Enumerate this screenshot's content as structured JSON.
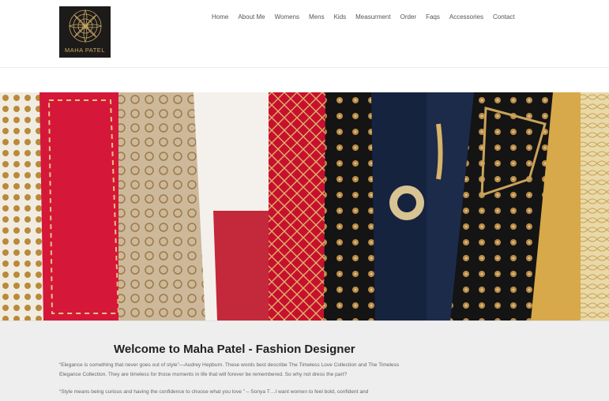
{
  "brand": {
    "logo_text": "MAHA PATEL",
    "logo_monogram": "M",
    "gold": "#c9a865",
    "dark": "#1d1b1a"
  },
  "nav": [
    "Home",
    "About Me",
    "Womens",
    "Mens",
    "Kids",
    "Measurment",
    "Order",
    "Faqs",
    "Accessories",
    "Contact"
  ],
  "hero": {
    "alt_theme": "embroidered-garments-rack"
  },
  "welcome": {
    "heading": "Welcome to Maha Patel - Fashion Designer",
    "paragraph_1": "“Elegance is something that never goes out of style”—Audrey Hepburn. These words best describe The Timeless Love Collection and The Timeless Elegance Collection. They are timeless for those moments in life that will forever be remembered. So why not dress the part?",
    "paragraph_2": "“Style means being curious and having the confidence to choose what you love ” – Sonya T…I want women to feel bold, confident and"
  }
}
